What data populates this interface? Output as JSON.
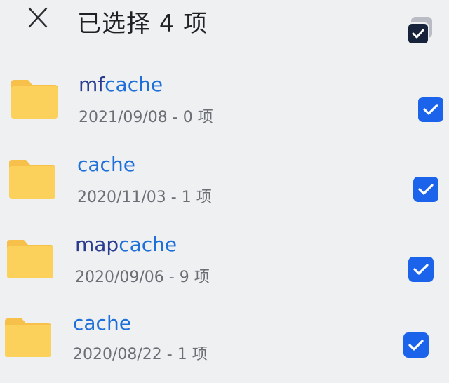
{
  "header": {
    "title": "已选择 4 项",
    "close_icon": "close-icon",
    "select_all_icon": "select-all-checkbox-icon"
  },
  "colors": {
    "background": "#eef0f1",
    "folder": "#fbd15b",
    "accent": "#1a63ea",
    "link": "#1e6fd9"
  },
  "files": [
    {
      "name_prefix": "mf",
      "name_match": "cache",
      "date": "2021/09/08",
      "separator": " - ",
      "count": "0 项",
      "checked": true
    },
    {
      "name_prefix": "",
      "name_match": "cache",
      "date": "2020/11/03",
      "separator": " - ",
      "count": "1 项",
      "checked": true
    },
    {
      "name_prefix": "map",
      "name_match": "cache",
      "date": "2020/09/06",
      "separator": " - ",
      "count": "9 项",
      "checked": true
    },
    {
      "name_prefix": "",
      "name_match": "cache",
      "date": "2020/08/22",
      "separator": " - ",
      "count": "1 项",
      "checked": true
    }
  ]
}
